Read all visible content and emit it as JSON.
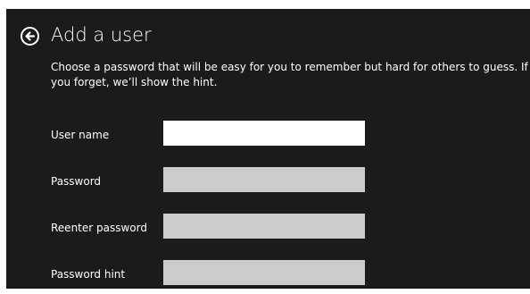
{
  "header": {
    "title": "Add a user",
    "back_icon": "back-arrow-circle-icon"
  },
  "description": "Choose a password that will be easy for you to remember but hard for others to guess. If you forget, we’ll show the hint.",
  "form": {
    "username_label": "User name",
    "username_value": "",
    "password_label": "Password",
    "password_value": "",
    "reenter_label": "Reenter password",
    "reenter_value": "",
    "hint_label": "Password hint",
    "hint_value": ""
  },
  "colors": {
    "background": "#1b1b1b",
    "text": "#ffffff",
    "field_active": "#ffffff",
    "field_inactive": "#cccccc"
  }
}
